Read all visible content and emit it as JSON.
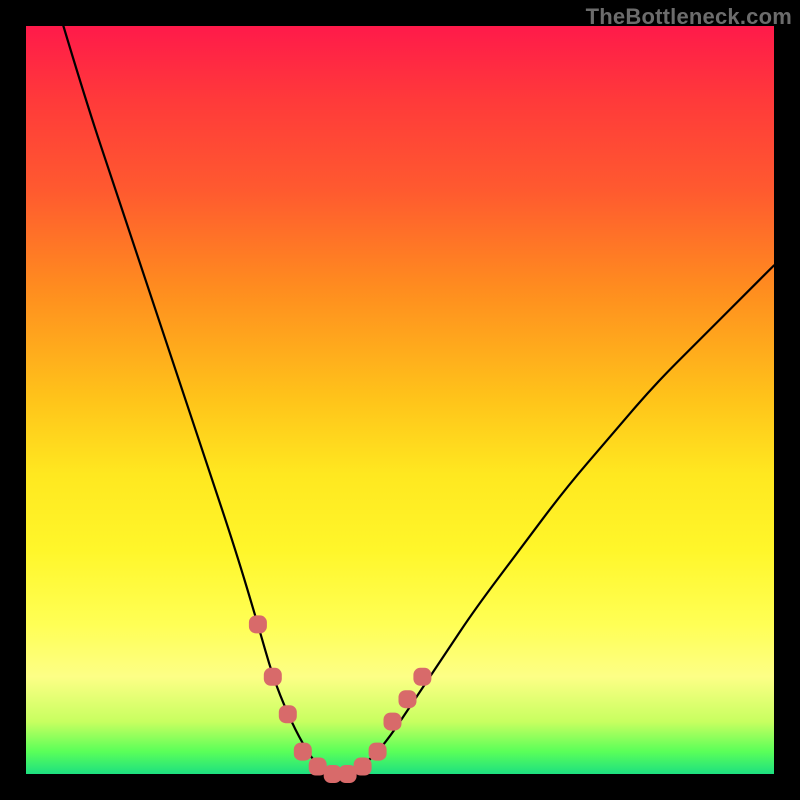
{
  "watermark": "TheBottleneck.com",
  "chart_data": {
    "type": "line",
    "title": "",
    "xlabel": "",
    "ylabel": "",
    "xlim": [
      0,
      100
    ],
    "ylim": [
      0,
      100
    ],
    "grid": false,
    "legend": false,
    "background_gradient": {
      "top": "#ff1a4a",
      "mid": "#ffe820",
      "bottom": "#1de080"
    },
    "series": [
      {
        "name": "bottleneck-curve",
        "color": "#000000",
        "x": [
          5,
          8,
          12,
          16,
          20,
          24,
          28,
          31,
          33,
          35,
          37,
          39,
          41,
          43,
          45,
          48,
          52,
          56,
          60,
          66,
          72,
          78,
          84,
          90,
          96,
          100
        ],
        "y": [
          100,
          90,
          78,
          66,
          54,
          42,
          30,
          20,
          13,
          8,
          4,
          1,
          0,
          0,
          1,
          4,
          10,
          16,
          22,
          30,
          38,
          45,
          52,
          58,
          64,
          68
        ]
      }
    ],
    "markers": [
      {
        "name": "highlight-points",
        "color": "#d86a6a",
        "shape": "rounded-square",
        "points": [
          {
            "x": 31,
            "y": 20
          },
          {
            "x": 33,
            "y": 13
          },
          {
            "x": 35,
            "y": 8
          },
          {
            "x": 37,
            "y": 3
          },
          {
            "x": 39,
            "y": 1
          },
          {
            "x": 41,
            "y": 0
          },
          {
            "x": 43,
            "y": 0
          },
          {
            "x": 45,
            "y": 1
          },
          {
            "x": 47,
            "y": 3
          },
          {
            "x": 49,
            "y": 7
          },
          {
            "x": 51,
            "y": 10
          },
          {
            "x": 53,
            "y": 13
          }
        ]
      }
    ]
  }
}
